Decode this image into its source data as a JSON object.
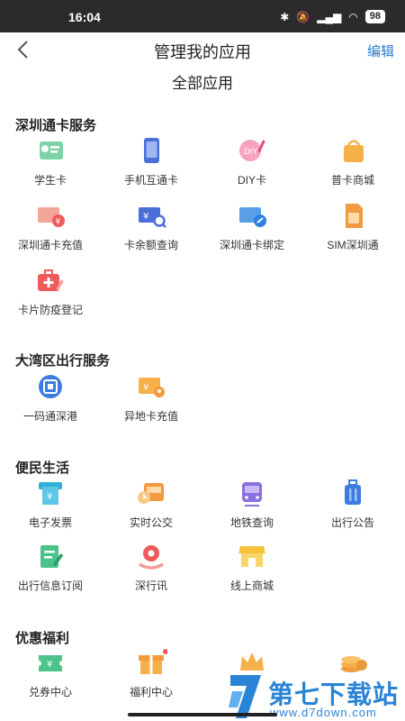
{
  "status_bar": {
    "time": "16:04",
    "battery": "98"
  },
  "header": {
    "title": "管理我的应用",
    "edit_label": "编辑"
  },
  "all_apps_title": "全部应用",
  "sections": [
    {
      "title": "深圳通卡服务",
      "apps": [
        "学生卡",
        "手机互通卡",
        "DIY卡",
        "普卡商城",
        "深圳通卡充值",
        "卡余额查询",
        "深圳通卡绑定",
        "SIM深圳通",
        "卡片防疫登记"
      ]
    },
    {
      "title": "大湾区出行服务",
      "apps": [
        "一码通深港",
        "异地卡充值"
      ]
    },
    {
      "title": "便民生活",
      "apps": [
        "电子发票",
        "实时公交",
        "地铁查询",
        "出行公告",
        "出行信息订阅",
        "深行讯",
        "线上商城"
      ]
    },
    {
      "title": "优惠福利",
      "apps": [
        "兑券中心",
        "福利中心",
        "",
        ""
      ]
    }
  ],
  "watermark": {
    "title": "第七下载站",
    "url": "www.d7down.com"
  },
  "colors": {
    "accent": "#2a7ad6",
    "orange": "#f29a3f",
    "red": "#ef5a5a",
    "green": "#4cc38a",
    "purple": "#8b6fe0"
  }
}
